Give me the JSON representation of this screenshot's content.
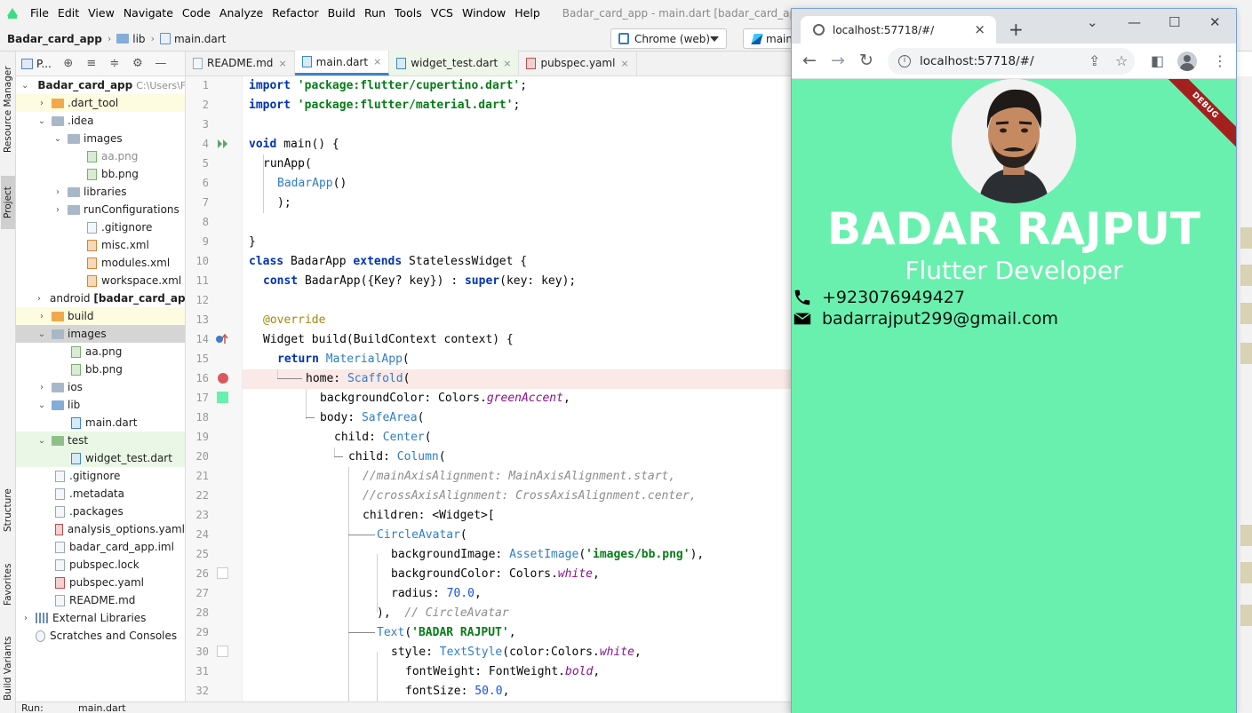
{
  "ide": {
    "menu": [
      "File",
      "Edit",
      "View",
      "Navigate",
      "Code",
      "Analyze",
      "Refactor",
      "Build",
      "Run",
      "Tools",
      "VCS",
      "Window",
      "Help"
    ],
    "title": "Badar_card_app - main.dart [badar_card_app]",
    "breadcrumb": {
      "project": "Badar_card_app",
      "folder": "lib",
      "file": "main.dart"
    },
    "device": "Chrome (web)",
    "config": "main",
    "stripe": {
      "resource_manager": "Resource Manager",
      "project": "Project",
      "structure": "Structure",
      "favorites": "Favorites",
      "build_variants": "Build Variants"
    },
    "panel_title": "P...",
    "tree": [
      {
        "label": "Badar_card_app",
        "extra": "C:\\Users\\F"
      },
      {
        "label": ".dart_tool"
      },
      {
        "label": ".idea"
      },
      {
        "label": "images"
      },
      {
        "label": "aa.png"
      },
      {
        "label": "bb.png"
      },
      {
        "label": "libraries"
      },
      {
        "label": "runConfigurations"
      },
      {
        "label": ".gitignore"
      },
      {
        "label": "misc.xml"
      },
      {
        "label": "modules.xml"
      },
      {
        "label": "workspace.xml"
      },
      {
        "label": "android",
        "extra": "[badar_card_app"
      },
      {
        "label": "build"
      },
      {
        "label": "images"
      },
      {
        "label": "aa.png"
      },
      {
        "label": "bb.png"
      },
      {
        "label": "ios"
      },
      {
        "label": "lib"
      },
      {
        "label": "main.dart"
      },
      {
        "label": "test"
      },
      {
        "label": "widget_test.dart"
      },
      {
        "label": ".gitignore"
      },
      {
        "label": ".metadata"
      },
      {
        "label": ".packages"
      },
      {
        "label": "analysis_options.yaml"
      },
      {
        "label": "badar_card_app.iml"
      },
      {
        "label": "pubspec.lock"
      },
      {
        "label": "pubspec.yaml"
      },
      {
        "label": "README.md"
      },
      {
        "label": "External Libraries"
      },
      {
        "label": "Scratches and Consoles"
      }
    ],
    "tabs": [
      "README.md",
      "main.dart",
      "widget_test.dart",
      "pubspec.yaml"
    ],
    "line_numbers": [
      "1",
      "2",
      "3",
      "4",
      "5",
      "6",
      "7",
      "8",
      "9",
      "10",
      "11",
      "12",
      "13",
      "14",
      "15",
      "16",
      "17",
      "18",
      "19",
      "20",
      "21",
      "22",
      "23",
      "24",
      "25",
      "26",
      "27",
      "28",
      "29",
      "30",
      "31",
      "32"
    ],
    "code": {
      "l1": {
        "a": "import",
        "b": " ",
        "c": "'package:flutter/cupertino.dart'",
        "d": ";"
      },
      "l2": {
        "a": "import",
        "b": " ",
        "c": "'package:flutter/material.dart'",
        "d": ";"
      },
      "l4": {
        "a": "void",
        "b": " main() {"
      },
      "l5": "runApp(",
      "l6": "BadarApp",
      "l6b": "()",
      "l7": ");",
      "l9": "}",
      "l10": {
        "a": "class",
        "b": " BadarApp ",
        "c": "extends",
        "d": " StatelessWidget {"
      },
      "l11": {
        "a": "const",
        "b": " BadarApp({Key? key}) : ",
        "c": "super",
        "d": "(key: key);"
      },
      "l13": "@override",
      "l14": "Widget build(BuildContext context) {",
      "l15": {
        "a": "return",
        "b": " ",
        "c": "MaterialApp",
        "d": "("
      },
      "l16": {
        "a": "home: ",
        "b": "Scaffold",
        "c": "("
      },
      "l17": {
        "a": "backgroundColor: Colors.",
        "b": "greenAccent",
        "c": ","
      },
      "l18": {
        "a": "body: ",
        "b": "SafeArea",
        "c": "("
      },
      "l19": {
        "a": "child: ",
        "b": "Center",
        "c": "("
      },
      "l20": {
        "a": "child: ",
        "b": "Column",
        "c": "("
      },
      "l21": "//mainAxisAlignment: MainAxisAlignment.start,",
      "l22": "//crossAxisAlignment: CrossAxisAlignment.center,",
      "l23": "children: <Widget>[",
      "l24": {
        "a": "CircleAvatar",
        "b": "("
      },
      "l25": {
        "a": "backgroundImage: ",
        "b": "AssetImage",
        "c": "(",
        "d": "'images/bb.png'",
        "e": "),"
      },
      "l26": {
        "a": "backgroundColor: Colors.",
        "b": "white",
        "c": ","
      },
      "l27": {
        "a": "radius: ",
        "b": "70.0",
        "c": ","
      },
      "l28": {
        "a": "),  ",
        "b": "// CircleAvatar"
      },
      "l29": {
        "a": "Text",
        "b": "(",
        "c": "'BADAR RAJPUT'",
        "d": ","
      },
      "l30": {
        "a": "style: ",
        "b": "TextStyle",
        "c": "(color:Colors.",
        "d": "white",
        "e": ","
      },
      "l31": {
        "a": "fontWeight: FontWeight.",
        "b": "bold",
        "c": ","
      },
      "l32": {
        "a": "fontSize: ",
        "b": "50.0",
        "c": ","
      }
    },
    "run_label": "Run:",
    "run_tab": "main.dart"
  },
  "browser": {
    "tab_title": "localhost:57718/#/",
    "url": "localhost:57718/#/"
  },
  "app": {
    "debug": "DEBUG",
    "name": "BADAR RAJPUT",
    "role": "Flutter Developer",
    "phone": "+923076949427",
    "email": "badarrajput299@gmail.com",
    "background": "#69f0ae"
  }
}
